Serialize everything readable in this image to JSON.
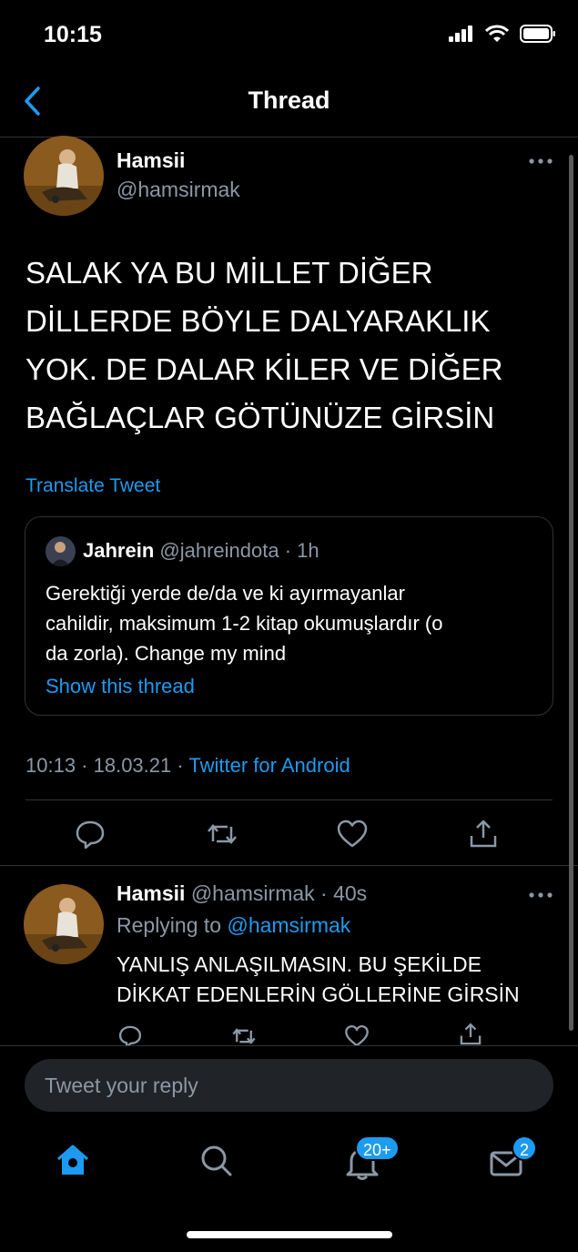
{
  "status_bar": {
    "time": "10:15"
  },
  "nav": {
    "title": "Thread"
  },
  "tweet": {
    "name": "Hamsii",
    "handle": "@hamsirmak",
    "lines": [
      "SALAK YA BU MİLLET DİĞER",
      "DİLLERDE BÖYLE DALYARAKLIK",
      "YOK. DE DALAR KİLER VE DİĞER",
      "BAĞLAÇLAR GÖTÜNÜZE GİRSİN"
    ],
    "translate_label": "Translate Tweet",
    "time": "10:13 · 18.03.21 ·",
    "source": "Twitter for Android"
  },
  "quote": {
    "name": "Jahrein",
    "handle_time": "@jahreindota · 1h",
    "lines": [
      "Gerektiği yerde de/da ve ki ayırmayanlar",
      "cahildir, maksimum 1-2 kitap okumuşlardır (o",
      "da zorla). Change my mind"
    ],
    "show_thread": "Show this thread"
  },
  "reply": {
    "name": "Hamsii",
    "handle_time": "@hamsirmak · 40s",
    "replying_prefix": "Replying to",
    "replying_to": "@hamsirmak",
    "lines": [
      "YANLIŞ ANLAŞILMASIN. BU ŞEKİLDE",
      "DİKKAT EDENLERİN GÖLLERİNE GİRSİN"
    ]
  },
  "compose": {
    "placeholder": "Tweet your reply"
  },
  "tabbar": {
    "notifications_badge": "20+",
    "messages_badge": "2"
  },
  "colors": {
    "accent": "#1d9bf0",
    "muted": "#8b98a5",
    "background": "#000000"
  },
  "icons": [
    "back-chevron-icon",
    "more-icon",
    "reply-icon",
    "retweet-icon",
    "like-icon",
    "share-icon",
    "home-icon",
    "search-icon",
    "bell-icon",
    "mail-icon"
  ]
}
